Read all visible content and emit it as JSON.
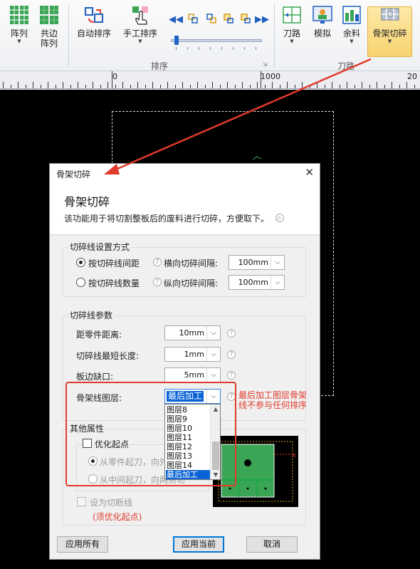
{
  "ribbon": {
    "buttons": [
      {
        "label": "阵列",
        "icon": "grid-array-icon"
      },
      {
        "label": "共边\n阵列",
        "icon": "shared-edge-array-icon"
      },
      {
        "label": "自动排序",
        "icon": "auto-sort-icon"
      },
      {
        "label": "手工排序",
        "icon": "manual-sort-icon"
      },
      {
        "label": "刀路",
        "icon": "toolpath-icon"
      },
      {
        "label": "模拟",
        "icon": "simulate-icon"
      },
      {
        "label": "余料",
        "icon": "remnant-icon"
      },
      {
        "label": "骨架切碎",
        "icon": "skeleton-cut-icon"
      }
    ],
    "groups": {
      "sort": "排序",
      "toolpath": "刀路"
    }
  },
  "ruler": {
    "labels": [
      "0",
      "1000",
      "20"
    ]
  },
  "dialog": {
    "title": "骨架切碎",
    "heading": "骨架切碎",
    "description": "该功能用于将切割整板后的废料进行切碎，方便取下。",
    "section_method": {
      "legend": "切碎线设置方式",
      "option_spacing": "按切碎线间距",
      "option_count": "按切碎线数量",
      "horizontal_label": "横向切碎间隔:",
      "horizontal_value": "100mm",
      "vertical_label": "纵向切碎间隔:",
      "vertical_value": "100mm"
    },
    "section_params": {
      "legend": "切碎线参数",
      "part_distance_label": "距零件距离:",
      "part_distance_value": "10mm",
      "min_length_label": "切碎线最短长度:",
      "min_length_value": "1mm",
      "edge_gap_label": "板边缺口:",
      "edge_gap_value": "5mm",
      "layer_label": "骨架线图层:",
      "layer_value": "最后加工",
      "layer_options": [
        "图层8",
        "图层9",
        "图层10",
        "图层11",
        "图层12",
        "图层13",
        "图层14",
        "最后加工"
      ]
    },
    "section_other": {
      "legend": "其他属性",
      "optimize_start": "优化起点",
      "from_part": "从零件起刀，向外",
      "from_middle": "从中间起刀，向两侧切",
      "set_cut_line": "设为切断线",
      "note": "(须优化起点)"
    },
    "buttons": {
      "apply_all": "应用所有",
      "apply_current": "应用当前",
      "cancel": "取消"
    }
  },
  "annotation": "最后加工图层骨架线不参与任何排序",
  "colors": {
    "accent_red": "#e03a2c",
    "selection_blue": "#0a64d8",
    "preview_green": "#3aa655"
  }
}
